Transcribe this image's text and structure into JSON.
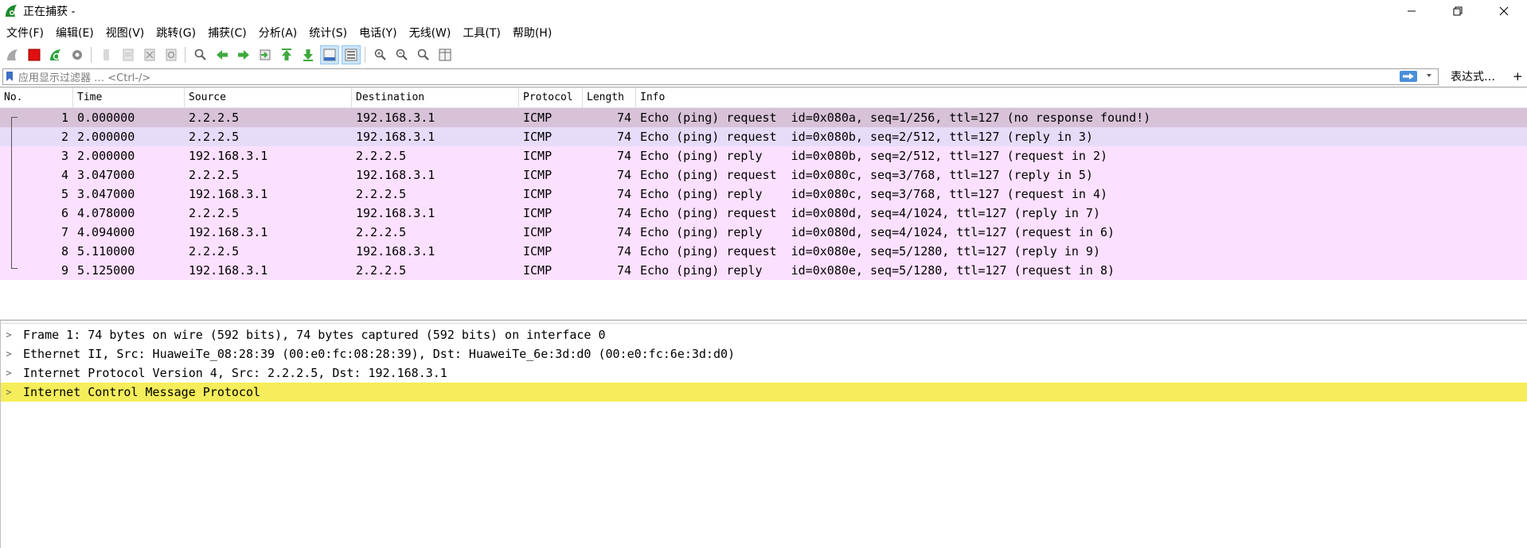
{
  "window": {
    "title": "正在捕获 -",
    "app_icon": "wireshark-fin-icon",
    "controls": [
      "minimize-icon",
      "restore-icon",
      "close-icon"
    ]
  },
  "menu": {
    "items": [
      {
        "label": "文件(F)"
      },
      {
        "label": "编辑(E)"
      },
      {
        "label": "视图(V)"
      },
      {
        "label": "跳转(G)"
      },
      {
        "label": "捕获(C)"
      },
      {
        "label": "分析(A)"
      },
      {
        "label": "统计(S)"
      },
      {
        "label": "电话(Y)"
      },
      {
        "label": "无线(W)"
      },
      {
        "label": "工具(T)"
      },
      {
        "label": "帮助(H)"
      }
    ]
  },
  "toolbar": {
    "buttons": [
      "start-capture-icon",
      "stop-capture-icon",
      "restart-capture-icon",
      "capture-options-icon",
      "open-file-icon",
      "save-file-icon",
      "close-file-icon",
      "reload-file-icon",
      "find-packet-icon",
      "go-back-icon",
      "go-forward-icon",
      "go-to-packet-icon",
      "go-first-icon",
      "go-last-icon",
      "auto-scroll-icon",
      "colorize-icon",
      "zoom-in-icon",
      "zoom-out-icon",
      "zoom-normal-icon",
      "resize-columns-icon"
    ]
  },
  "filter": {
    "placeholder": "应用显示过滤器 … <Ctrl-/>",
    "expression_label": "表达式…",
    "add_label": "+"
  },
  "packet_list": {
    "columns": [
      "No.",
      "Time",
      "Source",
      "Destination",
      "Protocol",
      "Length",
      "Info"
    ],
    "rows": [
      {
        "no": "1",
        "time": "0.000000",
        "src": "2.2.2.5",
        "dst": "192.168.3.1",
        "proto": "ICMP",
        "len": "74",
        "info": "Echo (ping) request  id=0x080a, seq=1/256, ttl=127 (no response found!)"
      },
      {
        "no": "2",
        "time": "2.000000",
        "src": "2.2.2.5",
        "dst": "192.168.3.1",
        "proto": "ICMP",
        "len": "74",
        "info": "Echo (ping) request  id=0x080b, seq=2/512, ttl=127 (reply in 3)"
      },
      {
        "no": "3",
        "time": "2.000000",
        "src": "192.168.3.1",
        "dst": "2.2.2.5",
        "proto": "ICMP",
        "len": "74",
        "info": "Echo (ping) reply    id=0x080b, seq=2/512, ttl=127 (request in 2)"
      },
      {
        "no": "4",
        "time": "3.047000",
        "src": "2.2.2.5",
        "dst": "192.168.3.1",
        "proto": "ICMP",
        "len": "74",
        "info": "Echo (ping) request  id=0x080c, seq=3/768, ttl=127 (reply in 5)"
      },
      {
        "no": "5",
        "time": "3.047000",
        "src": "192.168.3.1",
        "dst": "2.2.2.5",
        "proto": "ICMP",
        "len": "74",
        "info": "Echo (ping) reply    id=0x080c, seq=3/768, ttl=127 (request in 4)"
      },
      {
        "no": "6",
        "time": "4.078000",
        "src": "2.2.2.5",
        "dst": "192.168.3.1",
        "proto": "ICMP",
        "len": "74",
        "info": "Echo (ping) request  id=0x080d, seq=4/1024, ttl=127 (reply in 7)"
      },
      {
        "no": "7",
        "time": "4.094000",
        "src": "192.168.3.1",
        "dst": "2.2.2.5",
        "proto": "ICMP",
        "len": "74",
        "info": "Echo (ping) reply    id=0x080d, seq=4/1024, ttl=127 (request in 6)"
      },
      {
        "no": "8",
        "time": "5.110000",
        "src": "2.2.2.5",
        "dst": "192.168.3.1",
        "proto": "ICMP",
        "len": "74",
        "info": "Echo (ping) request  id=0x080e, seq=5/1280, ttl=127 (reply in 9)"
      },
      {
        "no": "9",
        "time": "5.125000",
        "src": "192.168.3.1",
        "dst": "2.2.2.5",
        "proto": "ICMP",
        "len": "74",
        "info": "Echo (ping) reply    id=0x080e, seq=5/1280, ttl=127 (request in 8)"
      }
    ],
    "colors": {
      "icmp_row": "#fce0ff",
      "selected_row": "#d8c2d8",
      "related_row": "#e6dcfa"
    }
  },
  "details": {
    "rows": [
      {
        "text": "Frame 1: 74 bytes on wire (592 bits), 74 bytes captured (592 bits) on interface 0"
      },
      {
        "text": "Ethernet II, Src: HuaweiTe_08:28:39 (00:e0:fc:08:28:39), Dst: HuaweiTe_6e:3d:d0 (00:e0:fc:6e:3d:d0)"
      },
      {
        "text": "Internet Protocol Version 4, Src: 2.2.2.5, Dst: 192.168.3.1"
      },
      {
        "text": "Internet Control Message Protocol"
      }
    ],
    "highlight_color": "#f5ee5a"
  }
}
